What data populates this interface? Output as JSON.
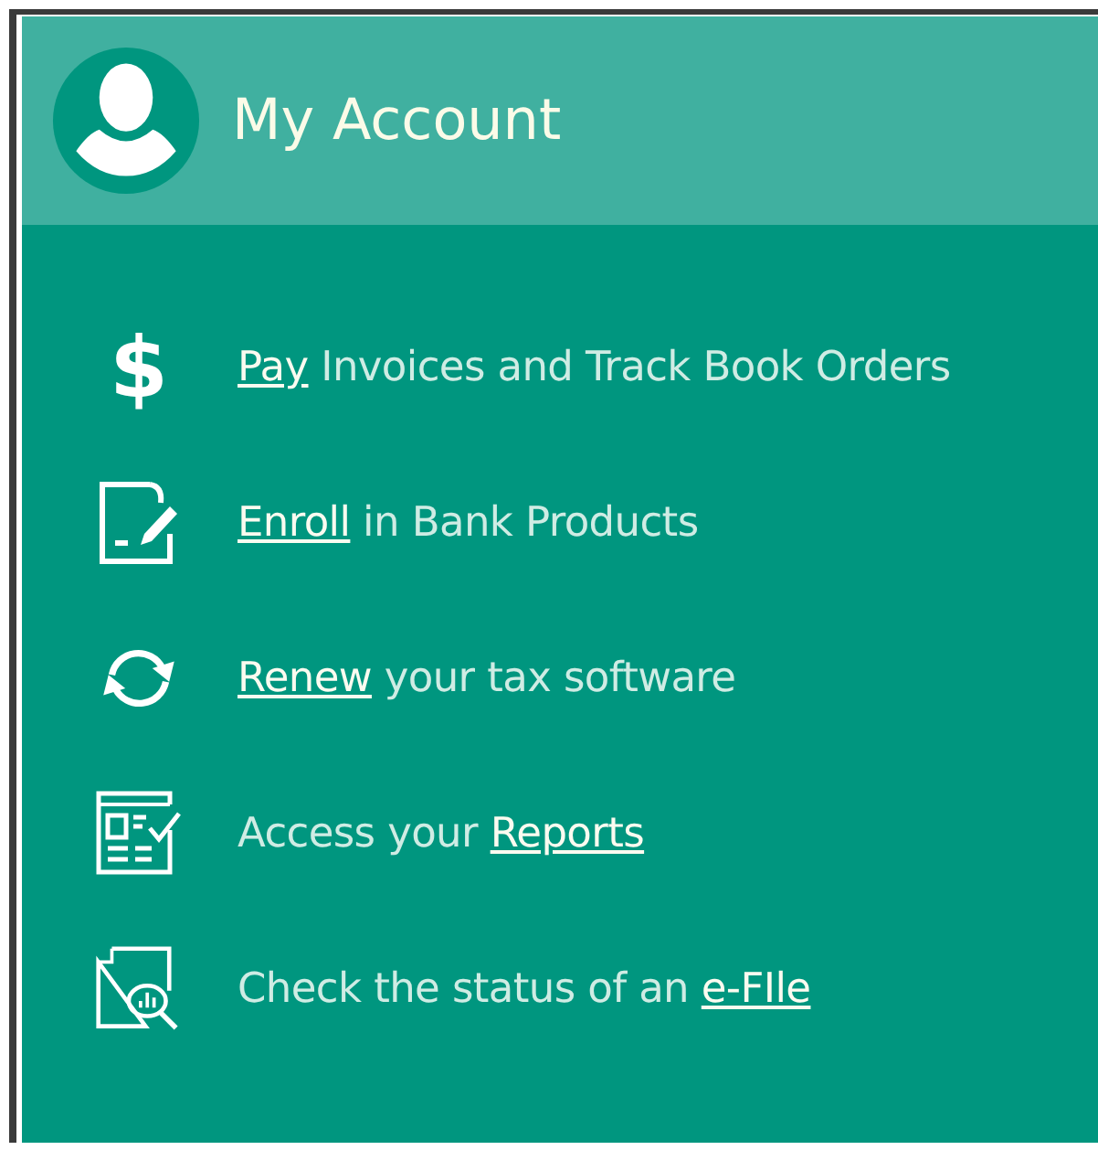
{
  "header": {
    "title": "My Account"
  },
  "items": [
    {
      "kind": "symbol",
      "symbol": "$",
      "parts": [
        {
          "text": "Pay",
          "link": true
        },
        {
          "text": " Invoices and Track Book Orders",
          "link": false
        }
      ]
    },
    {
      "kind": "document-pen",
      "parts": [
        {
          "text": "Enroll",
          "link": true
        },
        {
          "text": " in Bank Products",
          "link": false
        }
      ]
    },
    {
      "kind": "refresh",
      "parts": [
        {
          "text": "Renew",
          "link": true
        },
        {
          "text": " your tax software",
          "link": false
        }
      ]
    },
    {
      "kind": "report",
      "parts": [
        {
          "text": "Access your ",
          "link": false
        },
        {
          "text": "Reports",
          "link": true
        }
      ]
    },
    {
      "kind": "search-document",
      "parts": [
        {
          "text": "Check the status of an ",
          "link": false
        },
        {
          "text": "e-FIle",
          "link": true
        }
      ]
    }
  ]
}
